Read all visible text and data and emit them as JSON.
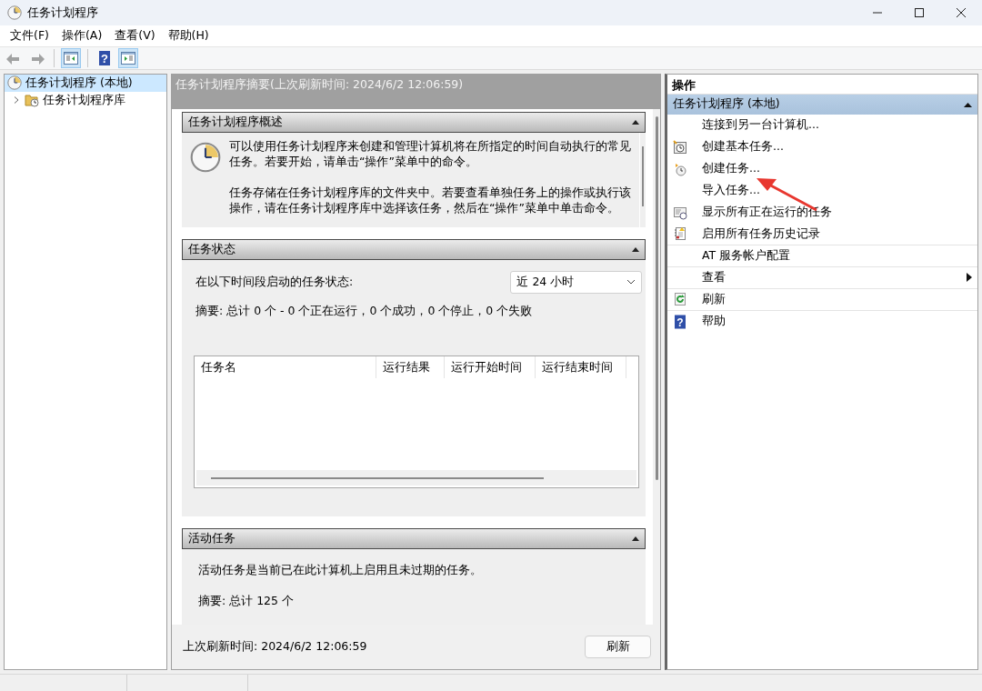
{
  "window": {
    "title": "任务计划程序"
  },
  "menu": [
    "文件(F)",
    "操作(A)",
    "查看(V)",
    "帮助(H)"
  ],
  "toolbar": [
    {
      "kind": "back",
      "disabled": true
    },
    {
      "kind": "forward",
      "disabled": true
    },
    {
      "kind": "separator"
    },
    {
      "kind": "console-tree",
      "pressed": true
    },
    {
      "kind": "separator"
    },
    {
      "kind": "help",
      "pressed": false,
      "glyph": "?"
    },
    {
      "kind": "action-pane",
      "pressed": true
    }
  ],
  "tree": [
    {
      "label": "任务计划程序 (本地)",
      "selected": true,
      "children": [
        {
          "label": "任务计划程序库",
          "selected": false,
          "expanded": false
        }
      ]
    }
  ],
  "summary": {
    "header": "任务计划程序摘要(上次刷新时间: 2024/6/2 12:06:59)",
    "sections": [
      {
        "kind": "overview",
        "title": "任务计划程序概述",
        "expanded": true,
        "paragraphs": [
          "可以使用任务计划程序来创建和管理计算机将在所指定的时间自动执行的常见任务。若要开始，请单击“操作”菜单中的命令。",
          "任务存储在任务计划程序库的文件夹中。若要查看单独任务上的操作或执行该操作，请在任务计划程序库中选择该任务，然后在“操作”菜单中单击命令。"
        ]
      },
      {
        "kind": "status",
        "title": "任务状态",
        "expanded": true,
        "label": "在以下时间段启动的任务状态:",
        "period": "近 24 小时",
        "summary": "摘要: 总计 0 个 - 0 个正在运行，0 个成功，0 个停止，0 个失败",
        "columns": [
          "任务名",
          "运行结果",
          "运行开始时间",
          "运行结束时间"
        ]
      },
      {
        "kind": "active",
        "title": "活动任务",
        "expanded": true,
        "paragraphs": [
          "活动任务是当前已在此计算机上启用且未过期的任务。",
          "摘要: 总计 125 个"
        ]
      }
    ],
    "footer_label": "上次刷新时间: 2024/6/2 12:06:59",
    "refresh_button": "刷新"
  },
  "actions": {
    "header": "操作",
    "group": {
      "title": "任务计划程序 (本地)",
      "expanded": true
    },
    "items": [
      {
        "label": "连接到另一台计算机...",
        "kind": "plain"
      },
      {
        "label": "创建基本任务...",
        "kind": "basic-task"
      },
      {
        "label": "创建任务...",
        "kind": "task"
      },
      {
        "label": "导入任务...",
        "kind": "plain"
      },
      {
        "label": "显示所有正在运行的任务",
        "kind": "running"
      },
      {
        "label": "启用所有任务历史记录",
        "kind": "history",
        "divider_after": true
      },
      {
        "label": "AT 服务帐户配置",
        "kind": "plain",
        "divider_after": true
      },
      {
        "label": "查看",
        "kind": "plain",
        "submenu": true,
        "divider_after": true
      },
      {
        "label": "刷新",
        "kind": "refresh",
        "divider_after": true
      },
      {
        "label": "帮助",
        "kind": "help",
        "glyph": "?"
      }
    ]
  },
  "annotation_arrow": true
}
